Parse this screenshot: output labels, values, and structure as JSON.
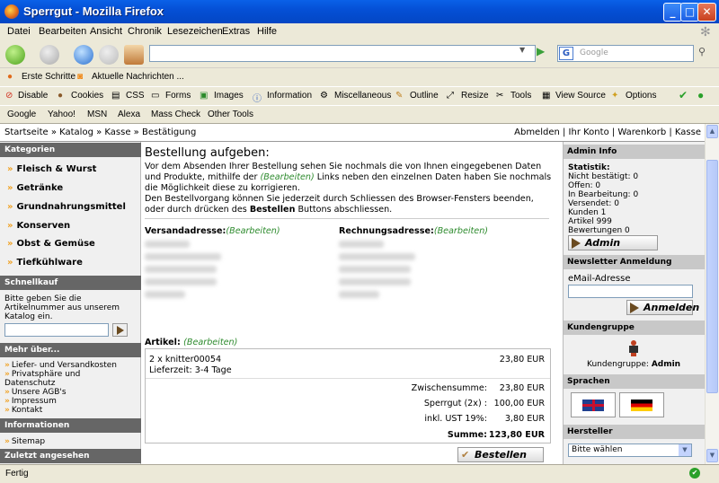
{
  "window": {
    "title": "Sperrgut - Mozilla Firefox"
  },
  "menu": [
    "Datei",
    "Bearbeiten",
    "Ansicht",
    "Chronik",
    "Lesezeichen",
    "Extras",
    "Hilfe"
  ],
  "search_engine_placeholder": "Google",
  "bookmarks": [
    "Erste Schritte",
    "Aktuelle Nachrichten ..."
  ],
  "devbar": [
    "Disable",
    "Cookies",
    "CSS",
    "Forms",
    "Images",
    "Information",
    "Miscellaneous",
    "Outline",
    "Resize",
    "Tools",
    "View Source",
    "Options"
  ],
  "searchbar": [
    "Google",
    "Yahoo!",
    "MSN",
    "Alexa",
    "Mass Check",
    "Other Tools"
  ],
  "breadcrumb": "Startseite » Katalog » Kasse » Bestätigung",
  "account_links": "Abmelden | Ihr Konto | Warenkorb | Kasse",
  "left": {
    "kategorien_head": "Kategorien",
    "categories": [
      "Fleisch & Wurst",
      "Getränke",
      "Grundnahrungsmittel",
      "Konserven",
      "Obst & Gemüse",
      "Tiefkühlware"
    ],
    "schnellkauf_head": "Schnellkauf",
    "schnellkauf_text": [
      "Bitte geben Sie die",
      "Artikelnummer aus unserem",
      "Katalog ein."
    ],
    "mehr_head": "Mehr über...",
    "mehr_items": [
      "Liefer- und Versandkosten",
      "Privatsphäre und",
      "Datenschutz",
      "Unsere AGB's",
      "Impressum",
      "Kontakt"
    ],
    "info_head": "Informationen",
    "info_items": [
      "Sitemap"
    ],
    "zuletzt_head": "Zuletzt angesehen"
  },
  "main": {
    "title": "Bestellung aufgeben:",
    "intro": [
      "Vor dem Absenden Ihrer Bestellung sehen Sie nochmals die von Ihnen eingegebenen Daten",
      "und Produkte, mithilfe der",
      "(Bearbeiten)",
      "Links neben den einzelnen Daten haben Sie nochmals",
      "die Möglichkeit diese zu korrigieren.",
      "Den Bestellvorgang können Sie jederzeit durch Schliessen des Browser-Fensters beenden,",
      "oder durch drücken des",
      "Bestellen",
      "Buttons abschliessen."
    ],
    "versand_label": "Versandadresse:",
    "rechnung_label": "Rechnungsadresse:",
    "edit_label": "(Bearbeiten)",
    "artikel_label": "Artikel:",
    "item_line": "2 x knitter00054",
    "item_price": "23,80 EUR",
    "item_delivery": "Lieferzeit: 3-4 Tage",
    "totals": [
      {
        "label": "Zwischensumme:",
        "value": "23,80 EUR"
      },
      {
        "label": "Sperrgut (2x) :",
        "value": "100,00 EUR"
      },
      {
        "label": "inkl. UST 19%:",
        "value": "3,80 EUR"
      },
      {
        "label": "Summe:",
        "value": "123,80 EUR"
      }
    ],
    "order_button": "Bestellen"
  },
  "right": {
    "admin_head": "Admin Info",
    "stats": [
      "Statistik:",
      "Nicht bestätigt: 0",
      "Offen: 0",
      "In Bearbeitung: 0",
      "Versendet: 0",
      "Kunden 1",
      "Artikel 999",
      "Bewertungen 0"
    ],
    "admin_button": "Admin",
    "newsletter_head": "Newsletter Anmeldung",
    "email_label": "eMail-Adresse",
    "login_button": "Anmelden",
    "kundengruppe_head": "Kundengruppe",
    "kundengruppe_text": "Kundengruppe:",
    "kundengruppe_value": "Admin",
    "sprachen_head": "Sprachen",
    "hersteller_head": "Hersteller",
    "hersteller_select": "Bitte wählen"
  },
  "status": "Fertig"
}
